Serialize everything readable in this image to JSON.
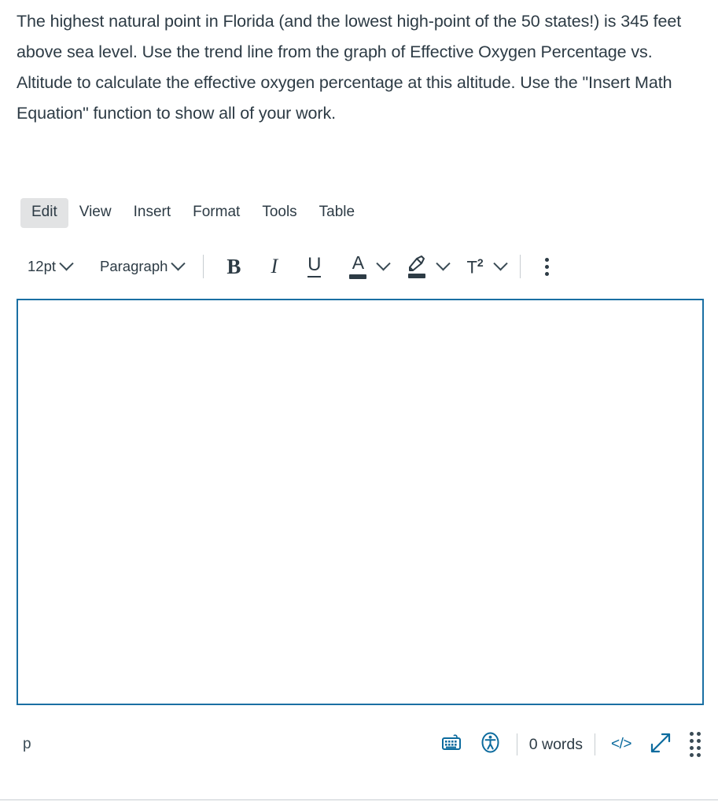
{
  "prompt": {
    "text": "The highest natural point in Florida (and the lowest high-point of the 50 states!) is 345 feet above sea level. Use the trend line from the graph of Effective Oxygen Percentage vs. Altitude to calculate the effective oxygen percentage at this altitude. Use the \"Insert Math Equation\" function to show all of your work."
  },
  "menubar": {
    "items": [
      {
        "label": "Edit",
        "active": true
      },
      {
        "label": "View",
        "active": false
      },
      {
        "label": "Insert",
        "active": false
      },
      {
        "label": "Format",
        "active": false
      },
      {
        "label": "Tools",
        "active": false
      },
      {
        "label": "Table",
        "active": false
      }
    ]
  },
  "toolbar": {
    "font_size": "12pt",
    "block_format": "Paragraph",
    "bold": "B",
    "italic": "I",
    "underline": "U",
    "text_color": "A",
    "superscript": "T",
    "superscript_exp": "2",
    "more_options": "more-options"
  },
  "editor": {
    "content": "",
    "placeholder": "",
    "border_color": "#1a6fa3"
  },
  "statusbar": {
    "element_path": "p",
    "keyboard_shortcuts": "keyboard-icon",
    "accessibility_checker": "accessibility-icon",
    "word_count": "0 words",
    "html_editor": "</>",
    "fullscreen": "expand-icon",
    "resize_handle": "resize-grip"
  },
  "colors": {
    "accent_blue": "#0c6b9e",
    "editor_border": "#1a6fa3",
    "text_dark": "#2d3b45",
    "menu_active_bg": "#e2e3e4",
    "separator": "#c7cdd1"
  }
}
